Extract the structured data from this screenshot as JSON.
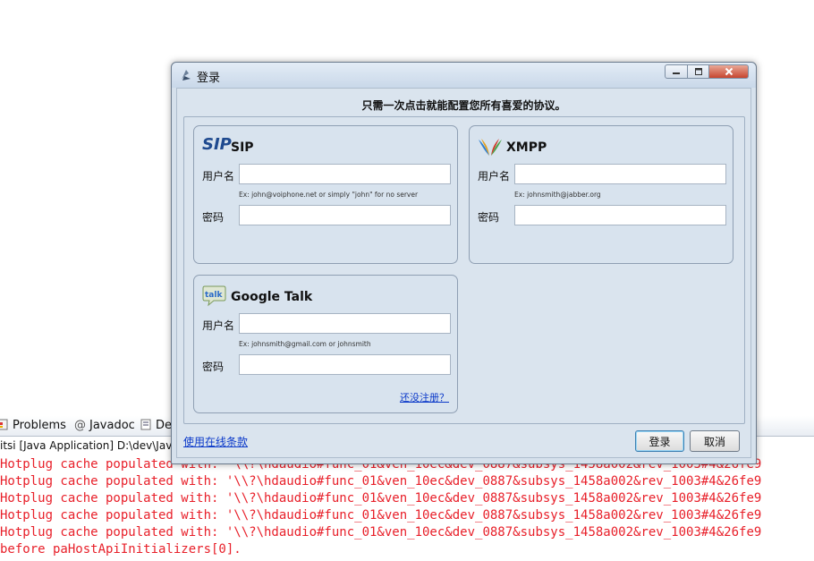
{
  "eclipse": {
    "tabs": [
      {
        "label": "Problems"
      },
      {
        "label": "Javadoc"
      },
      {
        "label": "De"
      }
    ],
    "console_title": "itsi [Java Application] D:\\dev\\Java",
    "console_lines": [
      "Hotplug cache populated with: '\\\\?\\hdaudio#func_01&ven_10ec&dev_0887&subsys_1458a002&rev_1003#4&26fe9",
      "Hotplug cache populated with: '\\\\?\\hdaudio#func_01&ven_10ec&dev_0887&subsys_1458a002&rev_1003#4&26fe9",
      "Hotplug cache populated with: '\\\\?\\hdaudio#func_01&ven_10ec&dev_0887&subsys_1458a002&rev_1003#4&26fe9",
      "Hotplug cache populated with: '\\\\?\\hdaudio#func_01&ven_10ec&dev_0887&subsys_1458a002&rev_1003#4&26fe9",
      "Hotplug cache populated with: '\\\\?\\hdaudio#func_01&ven_10ec&dev_0887&subsys_1458a002&rev_1003#4&26fe9",
      "before paHostApiInitializers[0]."
    ],
    "console_color": "#e8202a"
  },
  "dialog": {
    "title": "登录",
    "heading": "只需一次点击就能配置您所有喜爱的协议。",
    "accounts": {
      "sip": {
        "logo_text": "SIP",
        "name": "SIP",
        "username_label": "用户名",
        "username_value": "",
        "username_hint": "Ex: john@voiphone.net or simply \"john\" for no server",
        "password_label": "密码",
        "password_value": ""
      },
      "xmpp": {
        "name": "XMPP",
        "username_label": "用户名",
        "username_value": "",
        "username_hint": "Ex: johnsmith@jabber.org",
        "password_label": "密码",
        "password_value": ""
      },
      "google": {
        "logo_text": "talk",
        "name": "Google Talk",
        "username_label": "用户名",
        "username_value": "",
        "username_hint": "Ex: johnsmith@gmail.com or johnsmith",
        "password_label": "密码",
        "password_value": "",
        "register_link": "还没注册？"
      }
    },
    "terms_link": "使用在线条款",
    "login_button": "登录",
    "cancel_button": "取消"
  },
  "colors": {
    "link": "#0b39c9",
    "dialog_bg": "#d6e1ec",
    "sip_blue": "#1f4a8f"
  }
}
